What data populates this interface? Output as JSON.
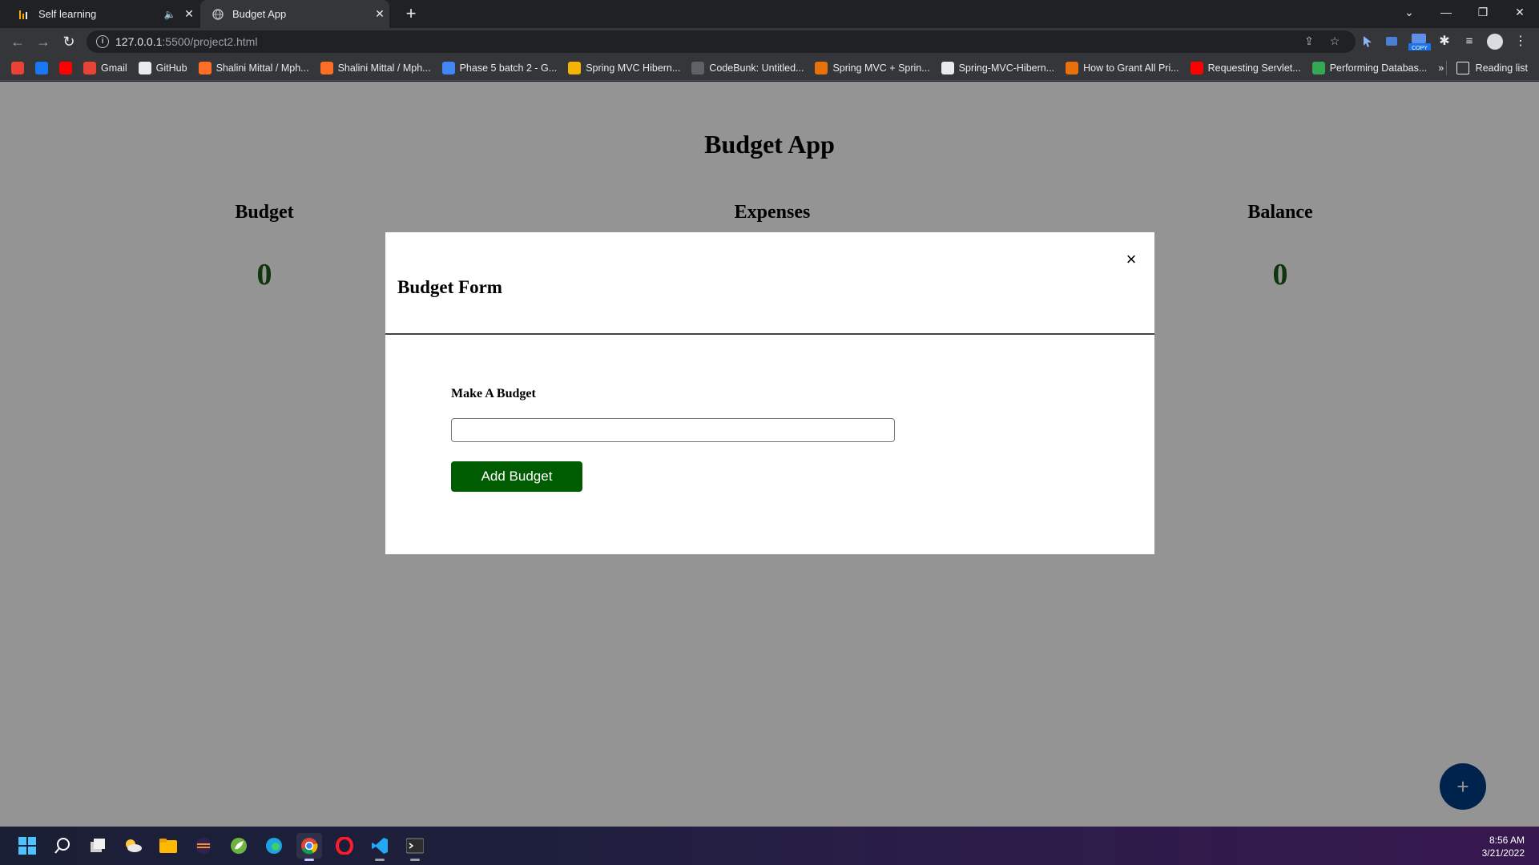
{
  "browser": {
    "tabs": [
      {
        "title": "Self learning",
        "active": false,
        "muted": true
      },
      {
        "title": "Budget App",
        "active": true,
        "muted": false
      }
    ],
    "url_host": "127.0.0.1",
    "url_path": ":5500/project2.html",
    "bookmarks": [
      {
        "label": "",
        "icon": "gmail-icon",
        "color": "#ea4335"
      },
      {
        "label": "",
        "icon": "facebook-icon",
        "color": "#1877f2"
      },
      {
        "label": "",
        "icon": "youtube-icon",
        "color": "#ff0000"
      },
      {
        "label": "Gmail",
        "icon": "gmail-icon",
        "color": "#ea4335"
      },
      {
        "label": "GitHub",
        "icon": "github-icon",
        "color": "#e8eaed"
      },
      {
        "label": "Shalini Mittal / Mph...",
        "icon": "gitlab-icon",
        "color": "#fc6d26"
      },
      {
        "label": "Shalini Mittal / Mph...",
        "icon": "gitlab-icon",
        "color": "#fc6d26"
      },
      {
        "label": "Phase 5 batch 2 - G...",
        "icon": "docs-icon",
        "color": "#4285f4"
      },
      {
        "label": "Spring MVC Hibern...",
        "icon": "page-icon",
        "color": "#f4b400"
      },
      {
        "label": "CodeBunk: Untitled...",
        "icon": "codebunk-icon",
        "color": "#5f6368"
      },
      {
        "label": "Spring MVC + Sprin...",
        "icon": "javatpoint-icon",
        "color": "#e8710a"
      },
      {
        "label": "Spring-MVC-Hibern...",
        "icon": "globe-icon",
        "color": "#e8eaed"
      },
      {
        "label": "How to Grant All Pri...",
        "icon": "alert-icon",
        "color": "#e8710a"
      },
      {
        "label": "Requesting Servlet...",
        "icon": "youtube-icon",
        "color": "#ff0000"
      },
      {
        "label": "Performing Databas...",
        "icon": "link-icon",
        "color": "#34a853"
      }
    ],
    "reading_list": "Reading list"
  },
  "app": {
    "title": "Budget App",
    "budget_label": "Budget",
    "budget_value": "0",
    "expenses_label": "Expenses",
    "balance_label": "Balance",
    "balance_value": "0"
  },
  "modal": {
    "title": "Budget Form",
    "close_glyph": "×",
    "field_label": "Make A Budget",
    "field_value": "",
    "button_label": "Add Budget"
  },
  "fab_glyph": "+",
  "taskbar": {
    "time": "8:56 AM",
    "date": "3/21/2022"
  },
  "colors": {
    "accent_green": "#005c00",
    "value_green": "#1d5e1d",
    "fab_blue": "#003d85"
  }
}
